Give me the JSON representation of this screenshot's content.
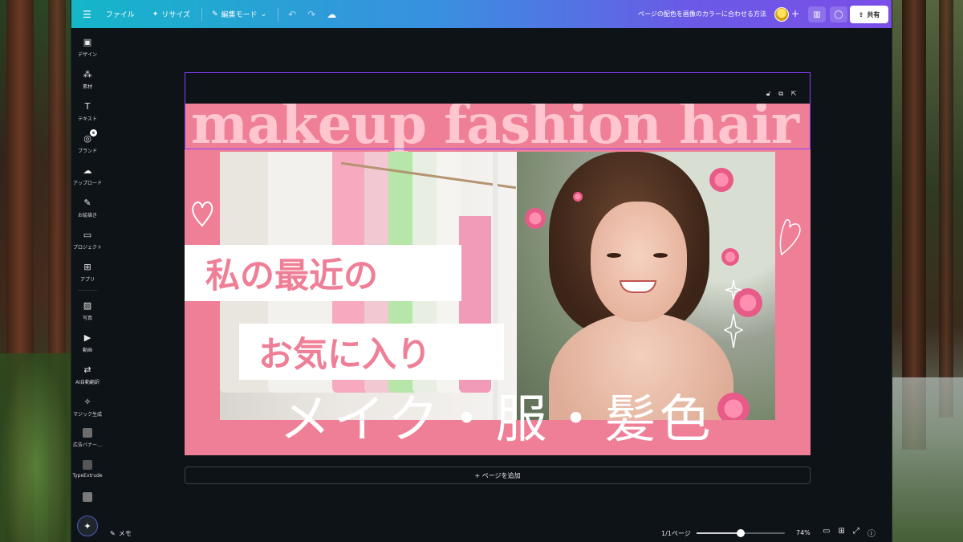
{
  "topbar": {
    "menu_icon": "hamburger-menu-icon",
    "file_label": "ファイル",
    "resize_label": "リサイズ",
    "edit_mode_label": "編集モード",
    "doc_title": "ページの配色を画像のカラーに合わせる方法",
    "share_label": "共有",
    "add_member_symbol": "+"
  },
  "sidebar": {
    "items": [
      {
        "label": "デザイン",
        "icon": "layout-icon"
      },
      {
        "label": "素材",
        "icon": "elements-icon"
      },
      {
        "label": "テキスト",
        "icon": "text-icon"
      },
      {
        "label": "ブランド",
        "icon": "brand-icon"
      },
      {
        "label": "アップロード",
        "icon": "upload-cloud-icon"
      },
      {
        "label": "お絵描き",
        "icon": "draw-pen-icon"
      },
      {
        "label": "プロジェクト",
        "icon": "folder-icon"
      },
      {
        "label": "アプリ",
        "icon": "apps-grid-icon"
      },
      {
        "label": "写真",
        "icon": "photo-icon"
      },
      {
        "label": "動画",
        "icon": "video-icon"
      },
      {
        "label": "AI自動翻訳",
        "icon": "translate-icon"
      },
      {
        "label": "マジック生成",
        "icon": "magic-media-icon"
      },
      {
        "label": "広告バナー…",
        "icon": "ad-banner-thumb-icon"
      },
      {
        "label": "TypeExtrude",
        "icon": "typeextrude-thumb-icon"
      }
    ]
  },
  "canvas": {
    "headline_en": "makeup fashion hair",
    "jp_line1": "私の最近の",
    "jp_line2": "お気に入り",
    "jp_main": "メイク・服・髪色",
    "add_page_label": "+ ページを追加",
    "colors": {
      "page_bg": "#ef7f97",
      "headline": "#ffc6cf",
      "selection": "#8b3dff"
    }
  },
  "bottombar": {
    "notes_label": "メモ",
    "page_count": "1/1ページ",
    "zoom_label": "74%",
    "zoom_fraction": 0.5
  }
}
